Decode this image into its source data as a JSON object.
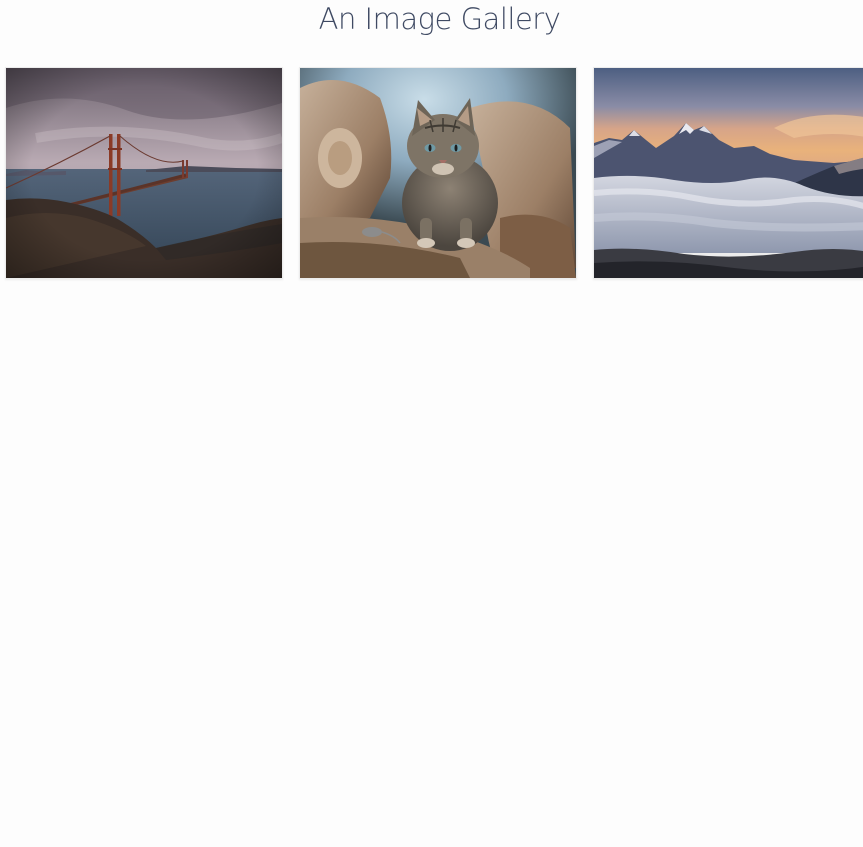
{
  "page": {
    "title": "An Image Gallery"
  },
  "gallery": {
    "images": [
      {
        "subject": "golden-gate-bridge"
      },
      {
        "subject": "tabby-cat-on-logs"
      },
      {
        "subject": "mountains-above-clouds"
      }
    ]
  },
  "colors": {
    "title": "#3f4a63",
    "background": "#fdfdfd"
  }
}
